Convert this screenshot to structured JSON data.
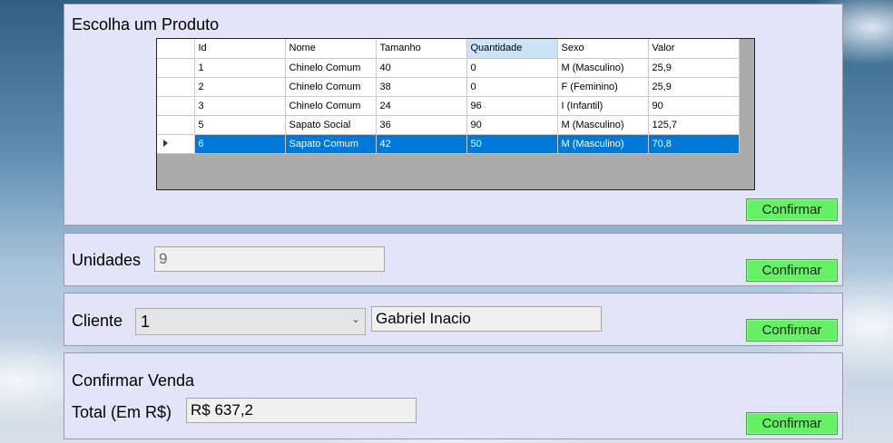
{
  "product_panel": {
    "title": "Escolha um Produto",
    "confirm_label": "Confirmar",
    "columns": [
      "Id",
      "Nome",
      "Tamanho",
      "Quantidade",
      "Sexo",
      "Valor"
    ],
    "rows": [
      [
        "1",
        "Chinelo Comum",
        "40",
        "0",
        "M (Masculino)",
        "25,9"
      ],
      [
        "2",
        "Chinelo Comum",
        "38",
        "0",
        "F (Feminino)",
        "25,9"
      ],
      [
        "3",
        "Chinelo Comum",
        "24",
        "96",
        "I (Infantil)",
        "90"
      ],
      [
        "5",
        "Sapato Social",
        "36",
        "90",
        "M (Masculino)",
        "125,7"
      ],
      [
        "6",
        "Sapato Comum",
        "42",
        "50",
        "M (Masculino)",
        "70,8"
      ]
    ]
  },
  "units_panel": {
    "label": "Unidades",
    "value": "9",
    "confirm_label": "Confirmar"
  },
  "client_panel": {
    "label": "Cliente",
    "selected_id": "1",
    "client_name": "Gabriel Inacio",
    "confirm_label": "Confirmar"
  },
  "sale_panel": {
    "title": "Confirmar Venda",
    "total_label": "Total (Em R$)",
    "total_value": "R$ 637,2",
    "confirm_label": "Confirmar"
  },
  "colors": {
    "panel_bg": "#e4e4f8",
    "button_green": "#66f066",
    "selection_blue": "#0078d7"
  }
}
